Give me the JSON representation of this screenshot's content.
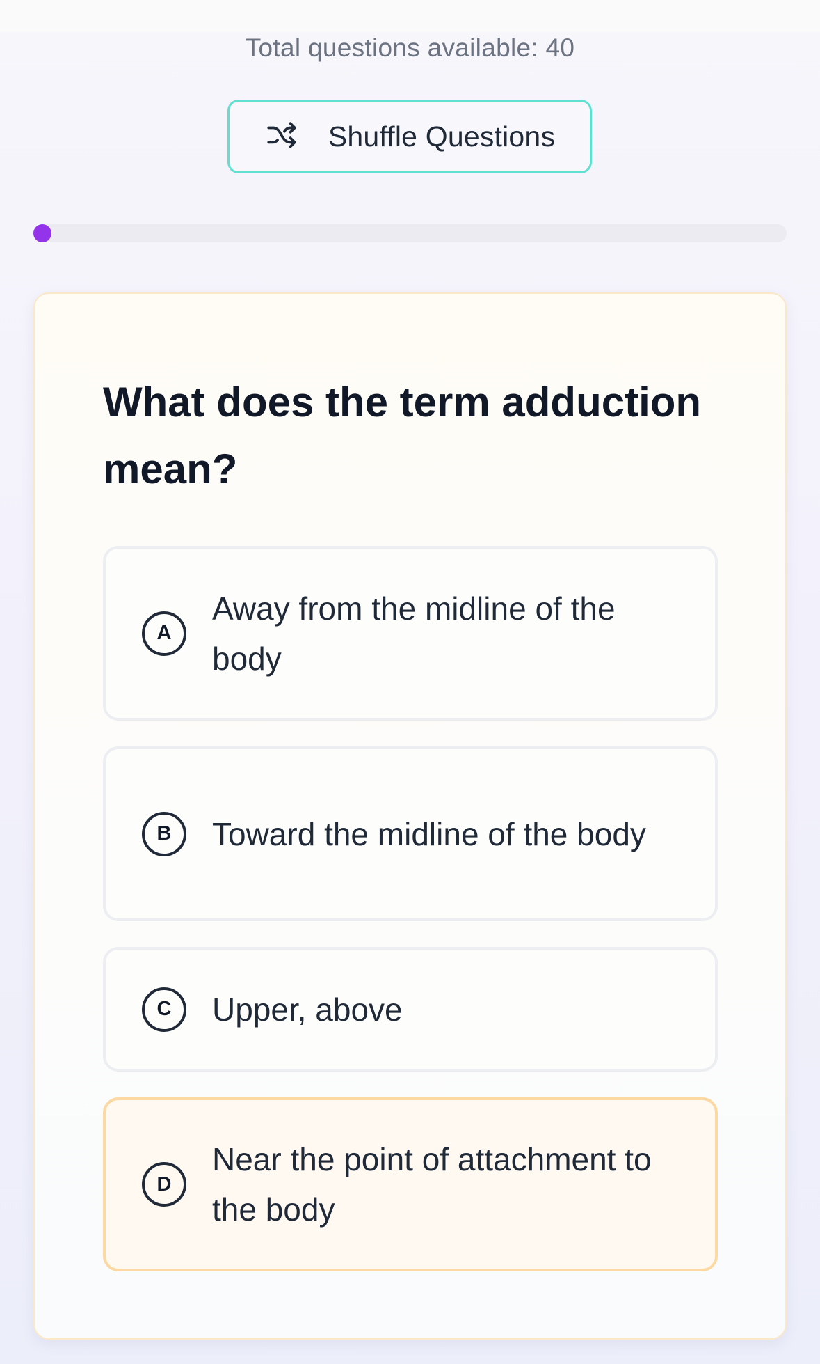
{
  "header": {
    "total_text": "Total questions available: 40"
  },
  "shuffle": {
    "label": "Shuffle Questions",
    "icon": "shuffle-icon",
    "border_color": "#5fe0d1"
  },
  "progress": {
    "value": 0,
    "color": "#9333ea"
  },
  "question": {
    "text": "What does the term adduction mean?"
  },
  "options": [
    {
      "letter": "A",
      "text": "Away from the midline of the body",
      "selected": false
    },
    {
      "letter": "B",
      "text": "Toward the midline of the body",
      "selected": false
    },
    {
      "letter": "C",
      "text": "Upper, above",
      "selected": false
    },
    {
      "letter": "D",
      "text": "Near the point of attachment to the body",
      "selected": true
    }
  ],
  "colors": {
    "selected_border": "#fcd9a3",
    "selected_background": "#fff9f1"
  }
}
